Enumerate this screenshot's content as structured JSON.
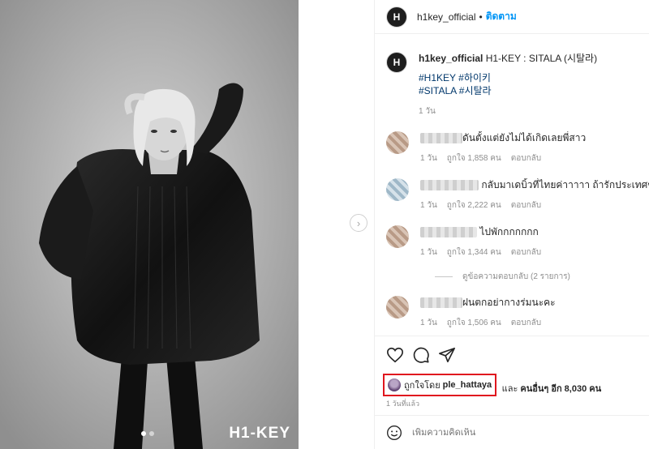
{
  "media": {
    "brand_text": "H1-KEY",
    "slide_count": 2,
    "active_slide": 1
  },
  "post": {
    "author": "h1key_official",
    "avatar_text": "H",
    "follow_label": "ติดตาม",
    "separator": "•",
    "caption_title": "H1-KEY : SITALA (시탈라)",
    "hashtags_line1": "#H1KEY #하이키",
    "hashtags_line2": "#SITALA #시탈라",
    "caption_time": "1 วัน"
  },
  "comments": [
    {
      "text": "ดันตั้งแต่ยังไม่ได้เกิดเลยพี่สาว",
      "time": "1 วัน",
      "likes": "ถูกใจ 1,858 คน",
      "reply": "ตอบกลับ"
    },
    {
      "text": "กลับมาเดบิ้วที่ไทยค่าาาาา ถ้ารักประเทศขนาด",
      "time": "1 วัน",
      "likes": "ถูกใจ 2,222 คน",
      "reply": "ตอบกลับ"
    },
    {
      "text": "ไปพักกกกกกก",
      "time": "1 วัน",
      "likes": "ถูกใจ 1,344 คน",
      "reply": "ตอบกลับ"
    },
    {
      "text": "ฝนตกอย่ากางร่มนะคะ",
      "time": "1 วัน",
      "likes": "ถูกใจ 1,506 คน",
      "reply": "ตอบกลับ"
    }
  ],
  "view_replies": "ดูข้อความตอบกลับ (2 รายการ)",
  "likes": {
    "prefix": "ถูกใจโดย",
    "user": "ple_hattaya",
    "and": "และ",
    "others": "คนอื่นๆ อีก 8,030 คน"
  },
  "post_time": "1 วันที่แล้ว",
  "add_comment_placeholder": "เพิ่มความคิดเห็น",
  "icons": [
    "heart-icon",
    "comment-icon",
    "share-icon",
    "emoji-icon",
    "chevron-right-icon"
  ]
}
